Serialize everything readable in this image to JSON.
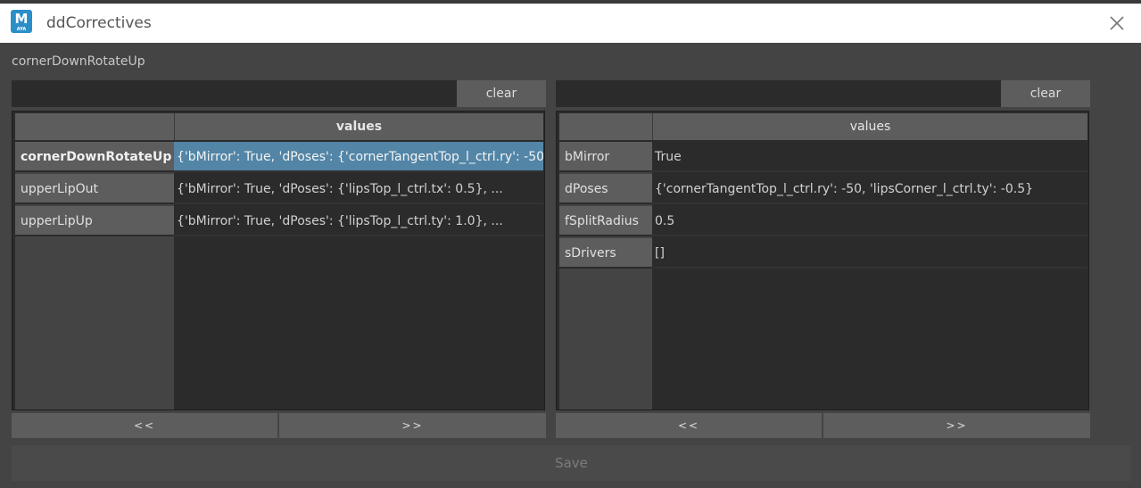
{
  "window": {
    "title": "ddCorrectives",
    "icon_letter": "M",
    "icon_sub": "AYA"
  },
  "pose_label": "cornerDownRotateUp",
  "left_panel": {
    "filter_value": "",
    "clear_label": "clear",
    "column_header": "values",
    "rows": [
      {
        "name": "cornerDownRotateUp",
        "value": "{'bMirror': True, 'dPoses': {'cornerTangentTop_l_ctrl.ry': -50..."
      },
      {
        "name": "upperLipOut",
        "value": "{'bMirror': True, 'dPoses': {'lipsTop_l_ctrl.tx': 0.5}, ..."
      },
      {
        "name": "upperLipUp",
        "value": "{'bMirror': True, 'dPoses': {'lipsTop_l_ctrl.ty': 1.0}, ..."
      }
    ],
    "prev_label": "<<",
    "next_label": ">>"
  },
  "right_panel": {
    "filter_value": "",
    "clear_label": "clear",
    "column_header": "values",
    "rows": [
      {
        "name": "bMirror",
        "value": "True"
      },
      {
        "name": "dPoses",
        "value": "{'cornerTangentTop_l_ctrl.ry': -50, 'lipsCorner_l_ctrl.ty': -0.5}"
      },
      {
        "name": "fSplitRadius",
        "value": "0.5"
      },
      {
        "name": "sDrivers",
        "value": "[]"
      }
    ],
    "prev_label": "<<",
    "next_label": ">>"
  },
  "save_label": "Save",
  "colors": {
    "background": "#444444",
    "selection": "#5285a6",
    "header": "#5d5d5d",
    "cell": "#2b2b2b"
  }
}
